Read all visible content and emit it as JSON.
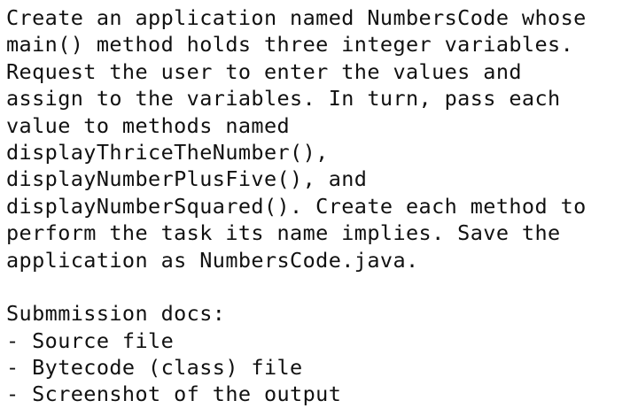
{
  "paragraph": [
    "Create an application named NumbersCode whose",
    "main() method holds three integer variables.",
    "Request the user to enter the values and",
    "assign to the variables. In turn, pass each",
    "value to methods named",
    "displayThriceTheNumber(),",
    "displayNumberPlusFive(), and",
    "displayNumberSquared(). Create each method to",
    "perform the task its name implies. Save the",
    "application as NumbersCode.java."
  ],
  "submission": {
    "heading": "Submmission docs:",
    "items": [
      "- Source file",
      "- Bytecode (class) file",
      "- Screenshot of the output"
    ]
  }
}
